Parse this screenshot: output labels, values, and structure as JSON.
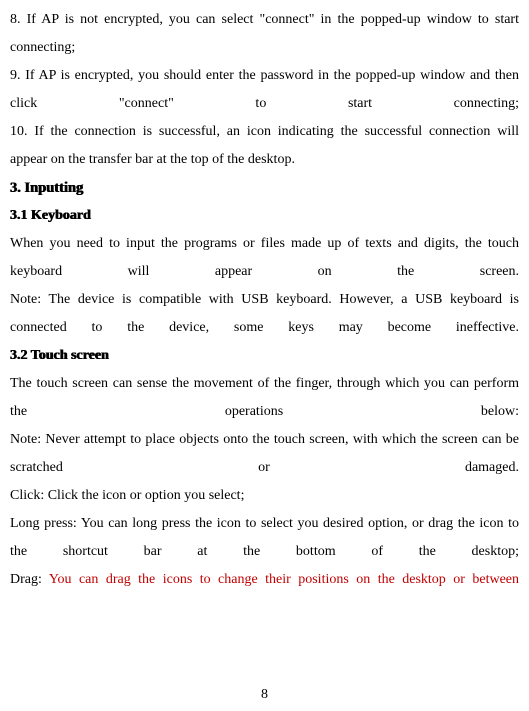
{
  "body": {
    "p8": "8. If AP is not encrypted, you can select \"connect\" in the popped-up window to start connecting;",
    "p9": "9. If AP is encrypted, you should enter the password in the popped-up window and then click \"connect\" to start connecting;",
    "p10": "10. If the connection is successful, an icon indicating the successful connection will appear on the transfer bar at the top of the desktop.",
    "h3": "3. Inputting",
    "h3_1": "3.1 Keyboard",
    "kb1": "When you need to input the programs or files made up of texts and digits, the touch keyboard will appear on the screen.",
    "kb_note": "Note: The device is compatible with USB keyboard. However, a USB keyboard is connected to the device, some keys may become ineffective.",
    "h3_2": "3.2 Touch screen",
    "ts1": "The touch screen can sense the movement of the finger, through which you can perform the operations below:",
    "ts_note": "Note: Never attempt to place objects onto the touch screen, with which the screen can be scratched or damaged.",
    "click": "Click: Click the icon or option you select;",
    "longpress": "Long press: You can long press the icon to select you desired option, or drag the icon to the shortcut bar at the bottom of the desktop;",
    "drag_prefix": "Drag: ",
    "drag_red": "You can drag the icons to change their positions on the desktop or between"
  },
  "page_number": "8"
}
